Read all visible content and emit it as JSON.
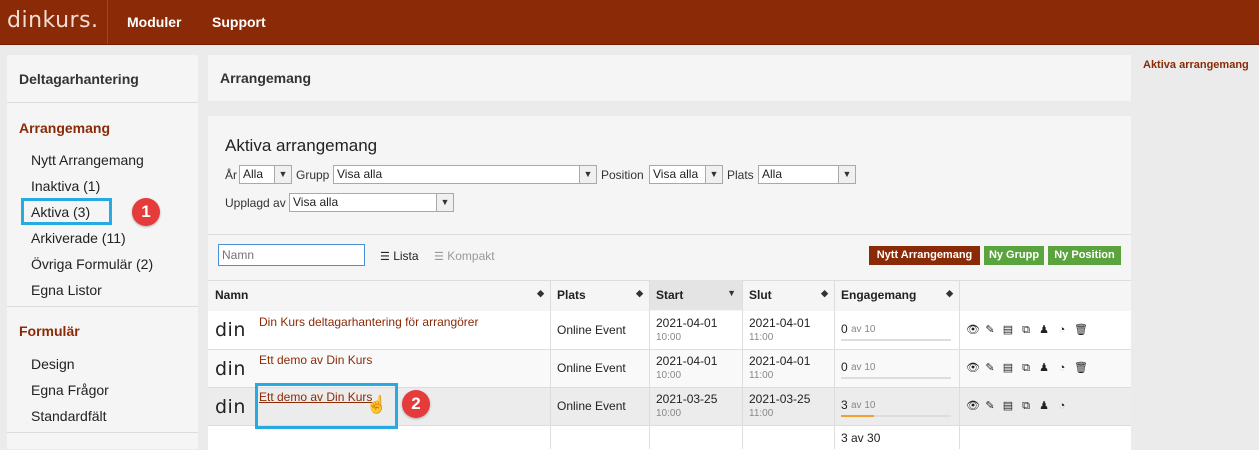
{
  "topbar": {
    "logo": "dinkurs.",
    "nav": [
      "Moduler",
      "Support"
    ]
  },
  "right_link": "Aktiva arrangemang",
  "sidebar": {
    "header": "Deltagarhantering",
    "sections": [
      {
        "title": "Arrangemang",
        "items": [
          "Nytt Arrangemang",
          "Inaktiva (1)",
          "Aktiva (3)",
          "Arkiverade (11)",
          "Övriga Formulär (2)",
          "Egna Listor"
        ]
      },
      {
        "title": "Formulär",
        "items": [
          "Design",
          "Egna Frågor",
          "Standardfält"
        ]
      }
    ]
  },
  "annotations": {
    "badge1": "1",
    "badge2": "2"
  },
  "page": {
    "title": "Arrangemang"
  },
  "main": {
    "heading": "Aktiva arrangemang",
    "filters": {
      "year_label": "År",
      "year_value": "Alla",
      "group_label": "Grupp",
      "group_value": "Visa alla",
      "position_label": "Position",
      "position_value": "Visa alla",
      "place_label": "Plats",
      "place_value": "Alla",
      "created_label": "Upplagd av",
      "created_value": "Visa alla"
    },
    "search_placeholder": "Namn",
    "view_list": "Lista",
    "view_compact": "Kompakt",
    "buttons": {
      "new_event": "Nytt Arrangemang",
      "new_group": "Ny Grupp",
      "new_position": "Ny Position"
    },
    "columns": [
      "Namn",
      "Plats",
      "Start",
      "Slut",
      "Engagemang"
    ],
    "rows": [
      {
        "logo": "din",
        "name": "Din Kurs deltagarhantering för arrangörer",
        "place": "Online Event",
        "start_date": "2021-04-01",
        "start_time": "10:00",
        "end_date": "2021-04-01",
        "end_time": "11:00",
        "eng_value": "0",
        "eng_total": "av 10"
      },
      {
        "logo": "din",
        "name": "Ett demo av Din Kurs",
        "place": "Online Event",
        "start_date": "2021-04-01",
        "start_time": "10:00",
        "end_date": "2021-04-01",
        "end_time": "11:00",
        "eng_value": "0",
        "eng_total": "av 10"
      },
      {
        "logo": "din",
        "name": "Ett demo av Din Kurs",
        "place": "Online Event",
        "start_date": "2021-03-25",
        "start_time": "10:00",
        "end_date": "2021-03-25",
        "end_time": "11:00",
        "eng_value": "3",
        "eng_total": "av 10"
      }
    ],
    "total": "3 av 30"
  },
  "colors": {
    "brand": "#8b2a06",
    "green": "#5aa33f",
    "highlight": "#27a9e1",
    "badge": "#e53b3b",
    "progress": "#f0a030"
  }
}
